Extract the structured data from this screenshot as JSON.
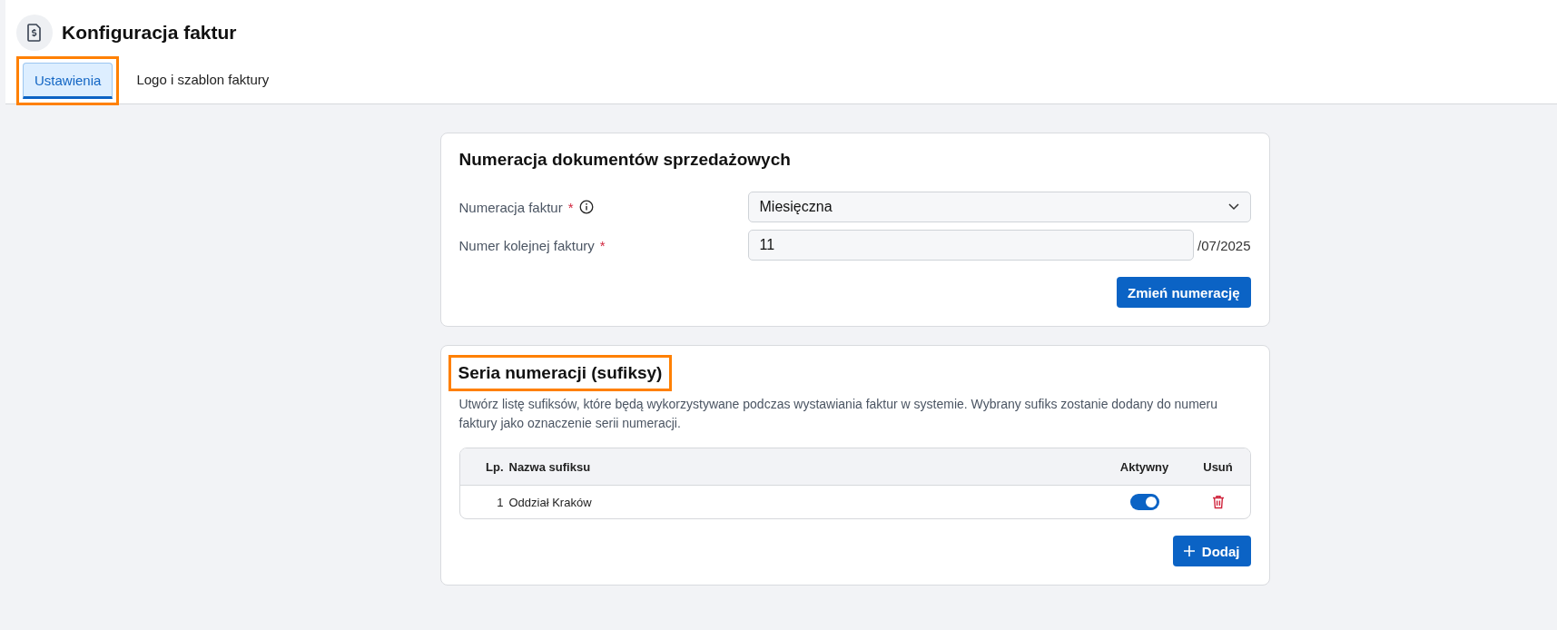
{
  "header": {
    "title": "Konfiguracja faktur"
  },
  "tabs": [
    {
      "label": "Ustawienia",
      "selected": true,
      "highlighted": true
    },
    {
      "label": "Logo i szablon faktury",
      "selected": false,
      "highlighted": false
    }
  ],
  "numbering_card": {
    "title": "Numeracja dokumentów sprzedażowych",
    "fields": [
      {
        "kind": "select",
        "label": "Numeracja faktur",
        "required_mark": "*",
        "info": true,
        "value": "Miesięczna"
      },
      {
        "kind": "input",
        "label": "Numer kolejnej faktury",
        "required_mark": "*",
        "value": "11",
        "suffix": "/07/2025"
      }
    ],
    "button": "Zmień numerację"
  },
  "suffix_card": {
    "title": "Seria numeracji (sufiksy)",
    "highlighted": true,
    "description": "Utwórz listę sufiksów, które będą wykorzystywane podczas wystawiania faktur w systemie. Wybrany sufiks zostanie dodany do numeru faktury jako oznaczenie serii numeracji.",
    "table": {
      "columns": [
        "Lp.",
        "Nazwa sufiksu",
        "Aktywny",
        "Usuń"
      ],
      "rows": [
        {
          "number": "1",
          "name": "Oddział Kraków",
          "active": true
        }
      ]
    },
    "button": "Dodaj"
  }
}
